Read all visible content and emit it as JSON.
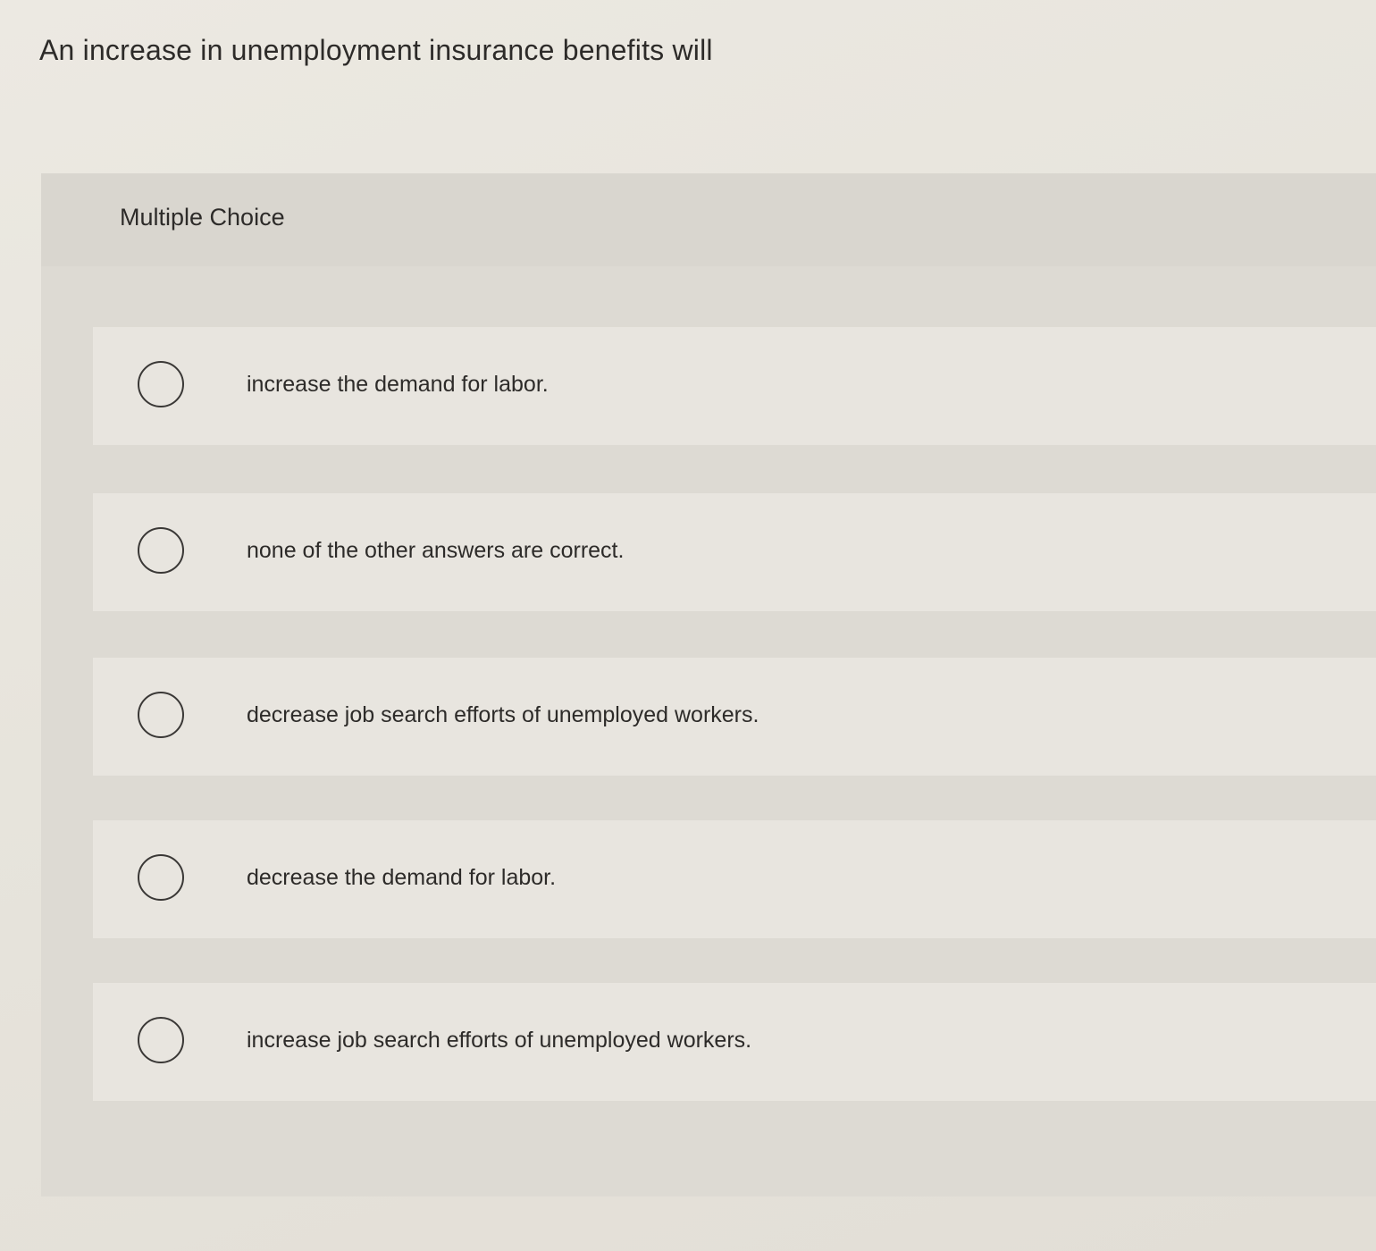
{
  "question": {
    "text": "An increase in unemployment insurance benefits will"
  },
  "panel": {
    "title": "Multiple Choice"
  },
  "options": [
    {
      "label": "increase the demand for labor.",
      "selected": false
    },
    {
      "label": "none of the other answers are correct.",
      "selected": false
    },
    {
      "label": "decrease job search efforts of unemployed workers.",
      "selected": false
    },
    {
      "label": "decrease the demand for labor.",
      "selected": false
    },
    {
      "label": "increase job search efforts of unemployed workers.",
      "selected": false
    }
  ]
}
